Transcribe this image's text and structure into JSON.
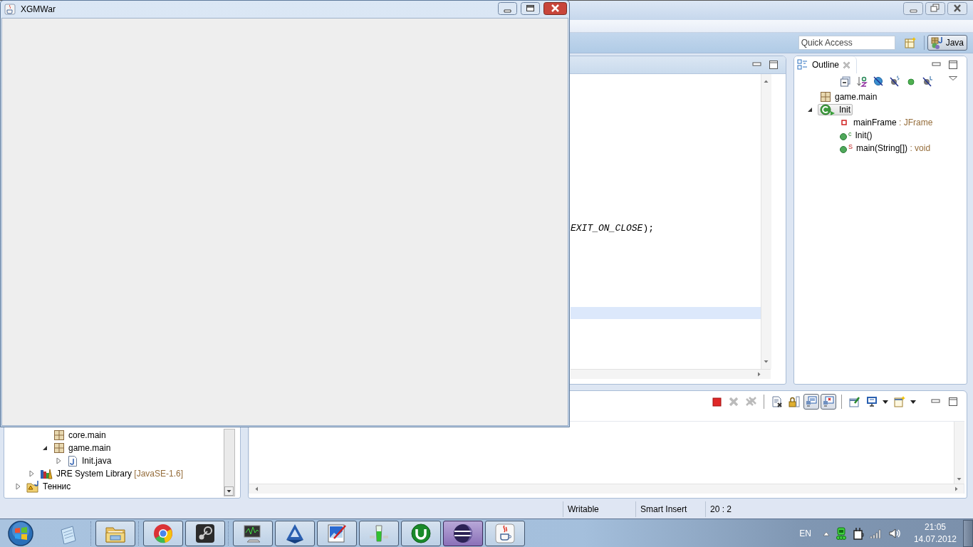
{
  "ide": {
    "window_buttons": [
      {
        "kind": "minimize"
      },
      {
        "kind": "restore"
      },
      {
        "kind": "close"
      }
    ],
    "quick_access": {
      "placeholder": "Quick Access"
    },
    "perspectives": [
      {
        "label": "Java",
        "selected": true
      }
    ],
    "editor": {
      "lines": [
        {
          "text": "*EXIT_ON_CLOSE*);",
          "current": false
        },
        {
          "current": false
        },
        {
          "current": false
        },
        {
          "current": false
        },
        {
          "current": false
        },
        {
          "current": false
        },
        {
          "current": false
        },
        {
          "current": true
        }
      ]
    },
    "outline": {
      "tab": "Outline",
      "toolbar": [
        {
          "kind": "collapse"
        },
        {
          "kind": "sort"
        },
        {
          "kind": "hide-fields"
        },
        {
          "kind": "hide-static"
        },
        {
          "kind": "hide-nonpublic"
        },
        {
          "kind": "hide-local"
        }
      ],
      "items": [
        {
          "kind": "package",
          "label": "game.main",
          "selected": false
        },
        {
          "kind": "class",
          "label": "Init",
          "selected": true,
          "expanded": true,
          "children": [
            {
              "kind": "field",
              "label": "mainFrame",
              "detail": " : JFrame",
              "selected": false
            },
            {
              "kind": "method",
              "badge": "c",
              "label": "Init()",
              "selected": false
            },
            {
              "kind": "method",
              "badge": "S",
              "label": "main(String[])",
              "detail": " : void",
              "selected": false
            }
          ]
        }
      ]
    },
    "package_explorer": {
      "tree": [
        {
          "children": [
            {
              "children": [
                {
                  "kind": "package",
                  "label": "core.main",
                  "selected": false
                },
                {
                  "kind": "package",
                  "label": "game.main",
                  "selected": false,
                  "expanded": true,
                  "children": [
                    {
                      "kind": "java-file",
                      "label": "Init.java",
                      "selected": false,
                      "expanded": false
                    }
                  ]
                }
              ]
            },
            {
              "kind": "library",
              "label": "JRE System Library",
              "detail": " [JavaSE-1.6]",
              "selected": false,
              "expanded": false
            }
          ]
        },
        {
          "kind": "project",
          "label": "Теннис",
          "selected": false,
          "expanded": false
        }
      ]
    },
    "console": {
      "toolbar_groups": [
        [
          {
            "kind": "terminate",
            "pressed": false,
            "disabled": false
          },
          {
            "kind": "remove",
            "pressed": false,
            "disabled": true
          },
          {
            "kind": "remove-all",
            "pressed": false,
            "disabled": true
          }
        ],
        [
          {
            "kind": "clear",
            "pressed": false,
            "disabled": false
          },
          {
            "kind": "scroll-lock",
            "pressed": false,
            "disabled": false
          },
          {
            "kind": "show-out",
            "pressed": true,
            "disabled": false
          },
          {
            "kind": "show-err",
            "pressed": true,
            "disabled": false
          }
        ],
        [
          {
            "kind": "pin",
            "pressed": false,
            "disabled": false
          },
          {
            "kind": "display",
            "pressed": false,
            "disabled": false,
            "dropdown": true
          },
          {
            "kind": "new",
            "pressed": false,
            "disabled": false,
            "dropdown": true
          }
        ]
      ]
    },
    "status_bar": [
      "Writable",
      "Smart Insert",
      "20 : 2"
    ]
  },
  "app_window": {
    "title": "XGMWar",
    "buttons": [
      {
        "kind": "minimize"
      },
      {
        "kind": "maximize"
      },
      {
        "kind": "close"
      }
    ]
  },
  "taskbar": {
    "buttons": [
      {
        "kind": "notepad",
        "running": false,
        "selected": false
      },
      {
        "kind": "folder",
        "running": true,
        "selected": false
      },
      {
        "kind": "browser",
        "running": true,
        "selected": false
      },
      {
        "kind": "steam",
        "running": true,
        "selected": false
      },
      {
        "kind": "monitor",
        "running": true,
        "selected": false
      },
      {
        "kind": "triangle",
        "running": true,
        "selected": false
      },
      {
        "kind": "paint",
        "running": true,
        "selected": false
      },
      {
        "kind": "glass",
        "running": true,
        "selected": false
      },
      {
        "kind": "torrent",
        "running": true,
        "selected": false
      },
      {
        "kind": "sphere",
        "running": true,
        "selected": true
      },
      {
        "kind": "cup",
        "running": true,
        "selected": false
      }
    ],
    "tray": {
      "language": "EN",
      "time": "21:05",
      "date": "14.07.2012"
    }
  }
}
